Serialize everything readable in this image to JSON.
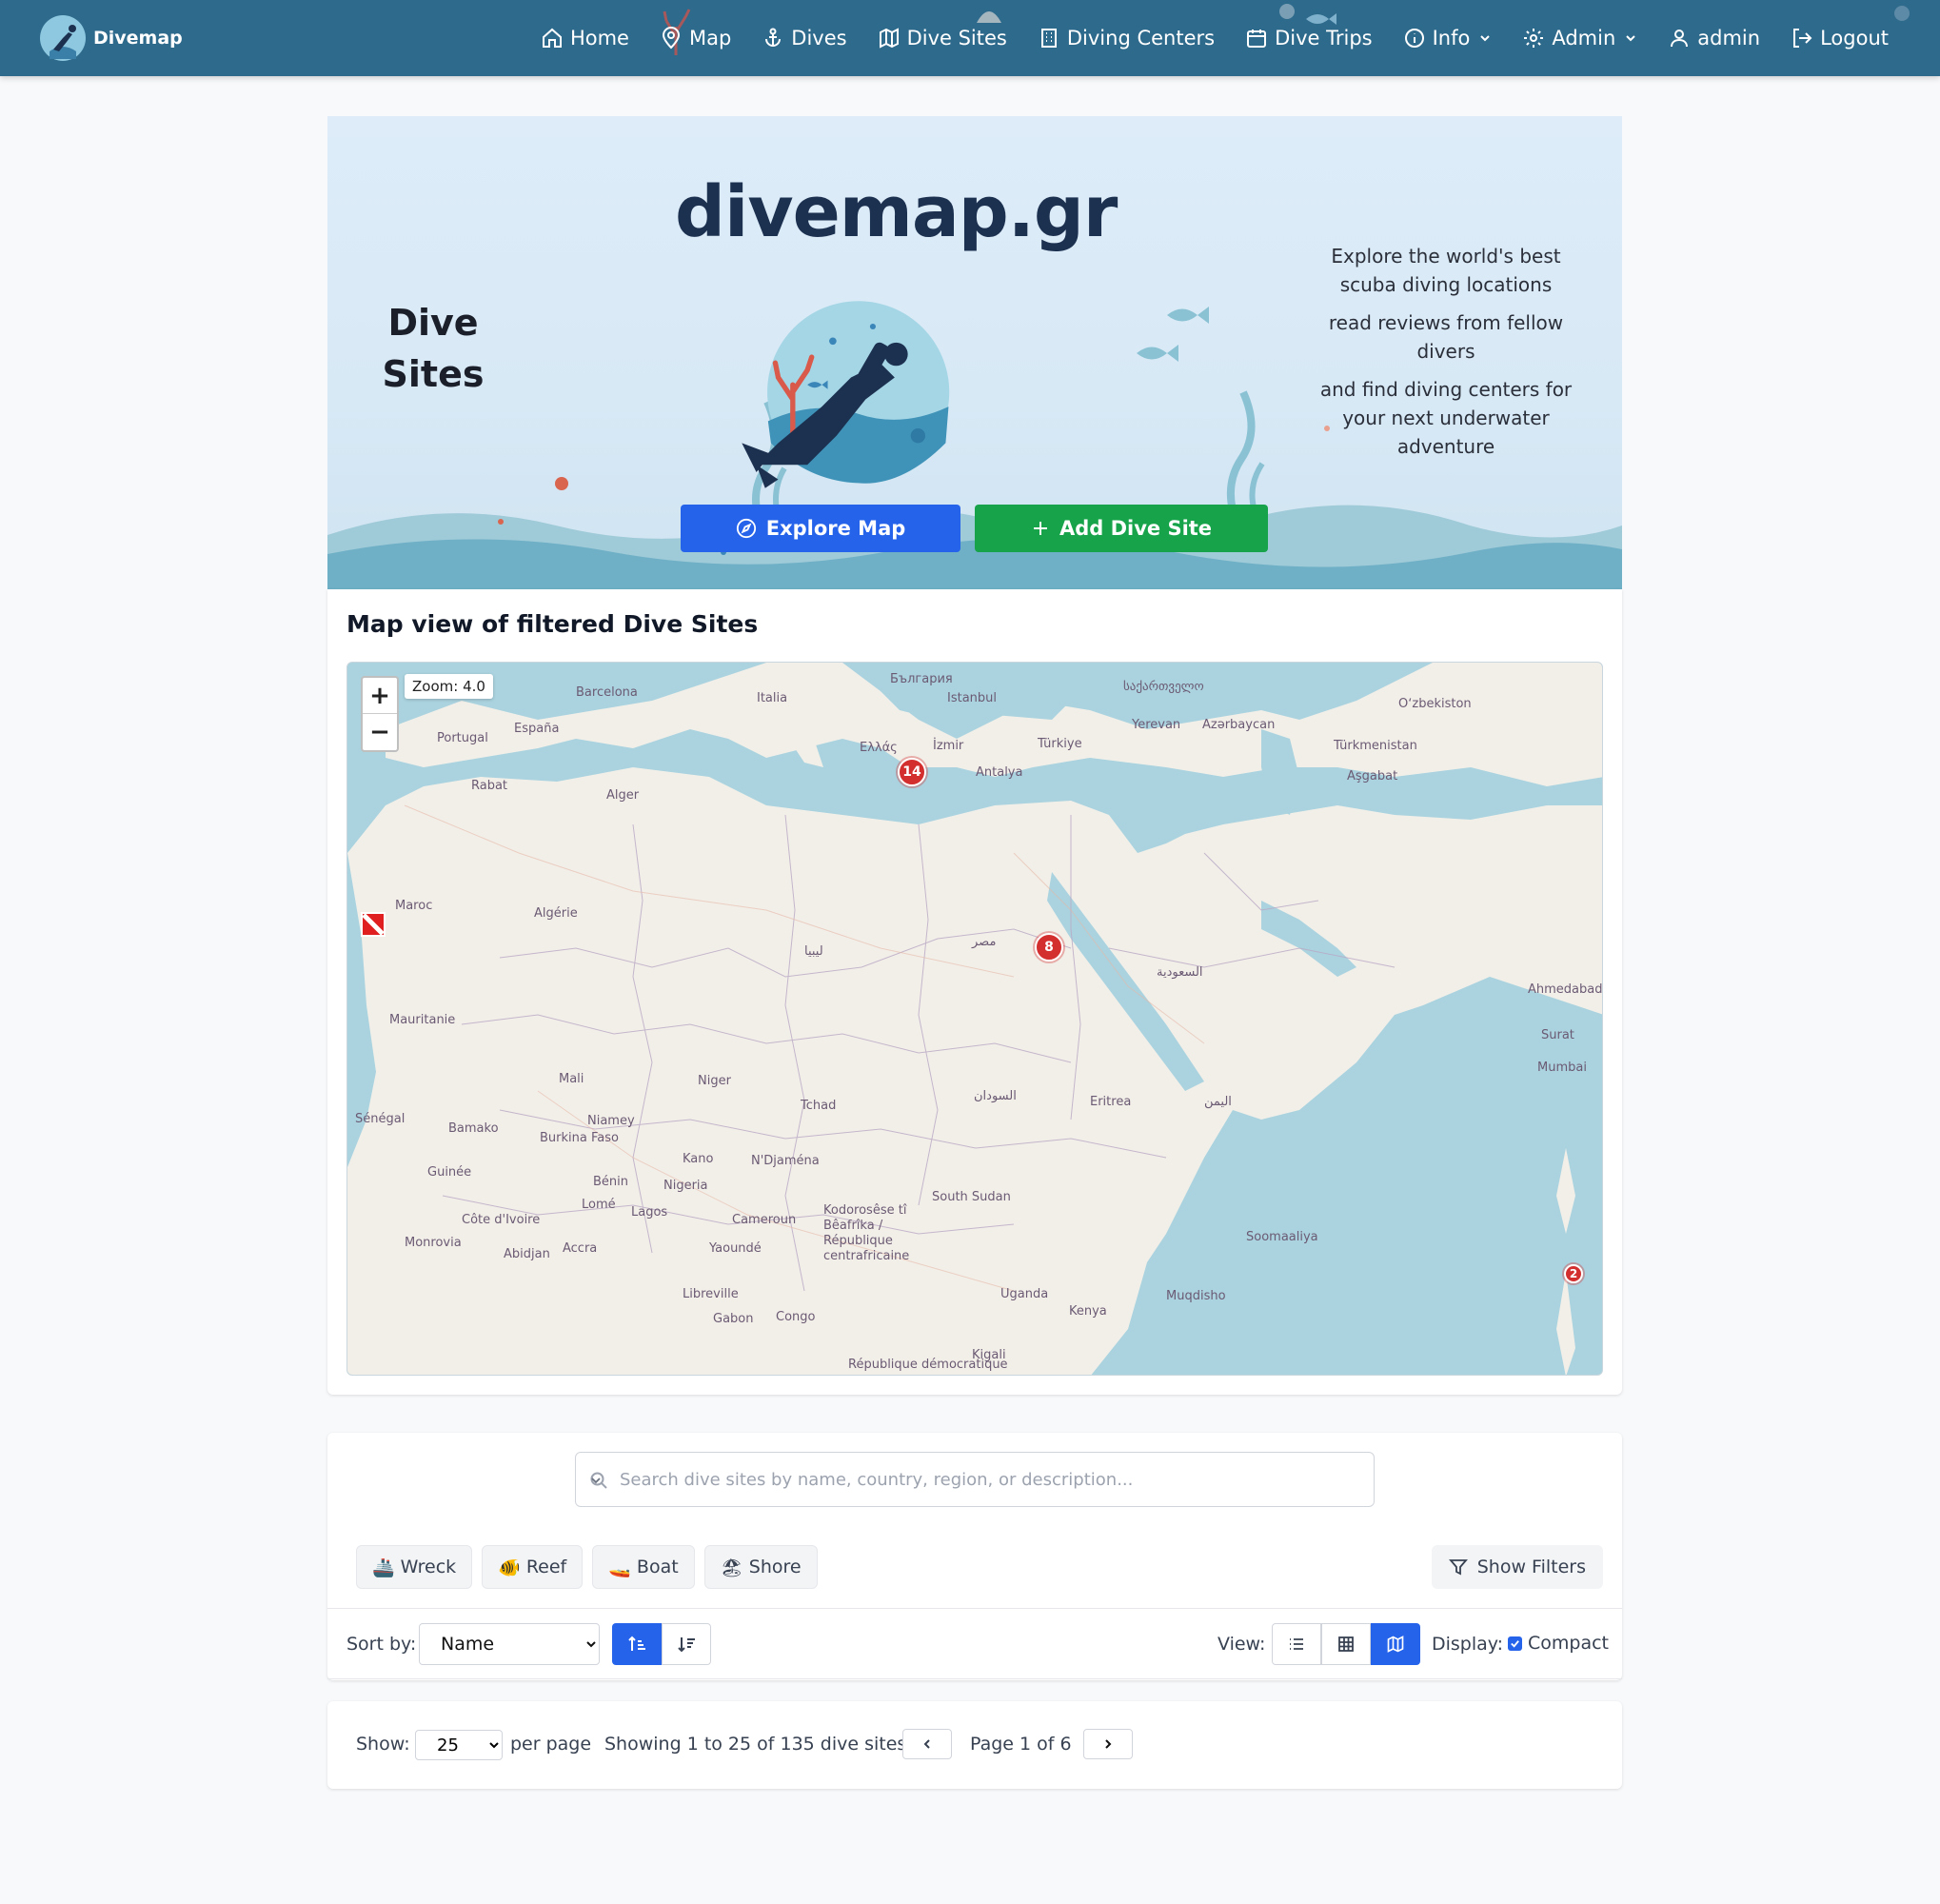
{
  "brand": {
    "name": "Divemap"
  },
  "nav": [
    {
      "label": "Home",
      "icon": "home-icon"
    },
    {
      "label": "Map",
      "icon": "map-pin-icon"
    },
    {
      "label": "Dives",
      "icon": "anchor-icon"
    },
    {
      "label": "Dive Sites",
      "icon": "map-icon"
    },
    {
      "label": "Diving Centers",
      "icon": "building-icon"
    },
    {
      "label": "Dive Trips",
      "icon": "calendar-icon"
    },
    {
      "label": "Info",
      "icon": "info-icon"
    },
    {
      "label": "Admin",
      "icon": "gear-icon"
    },
    {
      "label": "admin",
      "icon": "user-icon"
    },
    {
      "label": "Logout",
      "icon": "logout-icon"
    }
  ],
  "hero": {
    "title": "Dive Sites",
    "logo_text": "divemap.gr",
    "desc": [
      "Explore the world's best scuba diving locations",
      "read reviews from fellow divers",
      "and find diving centers for your next underwater adventure"
    ],
    "explore_label": "Explore Map",
    "add_label": "Add Dive Site"
  },
  "map": {
    "title": "Map view of filtered Dive Sites",
    "zoom_in": "+",
    "zoom_out": "−",
    "zoom_label": "Zoom: 4.0",
    "clusters": [
      "14",
      "8",
      "2"
    ],
    "labels": [
      "Barcelona",
      "Italia",
      "България",
      "Istanbul",
      "საქართველო",
      "Portugal",
      "España",
      "Ελλάς",
      "İzmir",
      "Türkiye",
      "Yerevan",
      "Azərbaycan",
      "Türkmenistan",
      "Oʻzbekiston",
      "Rabat",
      "Alger",
      "Antalya",
      "Aşgabat",
      "Maroc",
      "Algérie",
      "ليبيا",
      "مصر",
      "السعودية",
      "Mauritanie",
      "Mali",
      "Niger",
      "Tchad",
      "السودان",
      "Eritrea",
      "اليمن",
      "Sénégal",
      "Bamako",
      "Niamey",
      "Burkina Faso",
      "Kano",
      "N'Djaména",
      "Nigeria",
      "Guinée",
      "Côte d'Ivoire",
      "Bénin",
      "Lomé",
      "Lagos",
      "Cameroun",
      "South Sudan",
      "Monrovia",
      "Abidjan",
      "Accra",
      "Yaoundé",
      "Soomaaliya",
      "Libreville",
      "Gabon",
      "Congo",
      "Uganda",
      "Kenya",
      "Muqdisho",
      "Kigali",
      "Ahmedabad",
      "Surat",
      "Mumbai",
      "Kodorosêse tî Bêafrîka / République centrafricaine",
      "République démocratique"
    ]
  },
  "search": {
    "placeholder": "Search dive sites by name, country, region, or description..."
  },
  "chips": [
    {
      "label": "Wreck",
      "emoji": "🚢"
    },
    {
      "label": "Reef",
      "emoji": "🐠"
    },
    {
      "label": "Boat",
      "emoji": "🚤"
    },
    {
      "label": "Shore",
      "emoji": "🏖"
    }
  ],
  "show_filters_label": "Show Filters",
  "sort": {
    "label": "Sort by:",
    "selected": "Name"
  },
  "view": {
    "label": "View:",
    "active": "map"
  },
  "display": {
    "label": "Display:",
    "compact_label": "Compact",
    "compact_checked": true
  },
  "pagination": {
    "show_label": "Show:",
    "per_page_value": "25",
    "per_page_label": "per page",
    "summary": "Showing 1 to 25 of 135 dive sites",
    "page_label": "Page 1 of 6"
  },
  "colors": {
    "navbar": "#2e6a8c",
    "primary": "#2563eb",
    "success": "#16a34a",
    "marker": "#d32f2f"
  }
}
